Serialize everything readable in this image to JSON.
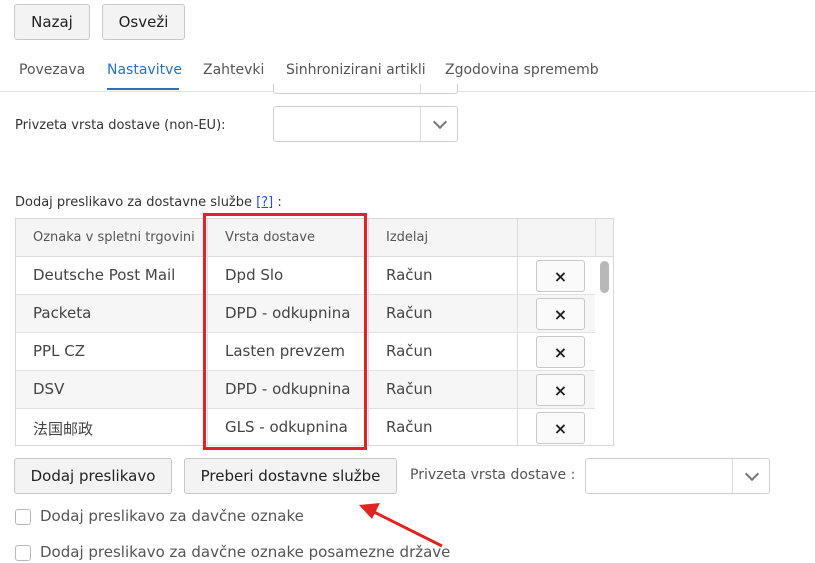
{
  "toolbar": {
    "back_label": "Nazaj",
    "refresh_label": "Osveži"
  },
  "tabs": [
    {
      "label": "Povezava"
    },
    {
      "label": "Nastavitve"
    },
    {
      "label": "Zahtevki"
    },
    {
      "label": "Sinhronizirani artikli"
    },
    {
      "label": "Zgodovina sprememb"
    }
  ],
  "active_tab": "Nastavitve",
  "default_shipping_non_eu": {
    "label": "Privzeta vrsta dostave (non-EU):",
    "value": ""
  },
  "mapping_section": {
    "title": "Dodaj preslikavo za dostavne službe",
    "help": "[?]",
    "colon": ":"
  },
  "grid": {
    "headers": [
      "Oznaka v spletni trgovini",
      "Vrsta dostave",
      "Izdelaj",
      ""
    ],
    "rows": [
      {
        "shop_label": "Deutsche Post Mail",
        "shipping_type": "Dpd Slo",
        "create": "Račun",
        "delete": "×"
      },
      {
        "shop_label": "Packeta",
        "shipping_type": "DPD - odkupnina",
        "create": "Račun",
        "delete": "×"
      },
      {
        "shop_label": "PPL CZ",
        "shipping_type": "Lasten prevzem",
        "create": "Račun",
        "delete": "×"
      },
      {
        "shop_label": "DSV",
        "shipping_type": "DPD - odkupnina",
        "create": "Račun",
        "delete": "×"
      },
      {
        "shop_label": "法国邮政",
        "shipping_type": "GLS - odkupnina",
        "create": "Račun",
        "delete": "×"
      }
    ]
  },
  "actions": {
    "add_mapping_label": "Dodaj preslikavo",
    "read_services_label": "Preberi dostavne službe",
    "default_shipping_label": "Privzeta vrsta dostave :",
    "default_shipping_value": ""
  },
  "checkboxes": [
    {
      "label": "Dodaj preslikavo za davčne oznake",
      "checked": false
    },
    {
      "label": "Dodaj preslikavo za davčne oznake posamezne države",
      "checked": false
    }
  ],
  "colors": {
    "accent": "#2b72b8",
    "highlight": "#e02424"
  }
}
